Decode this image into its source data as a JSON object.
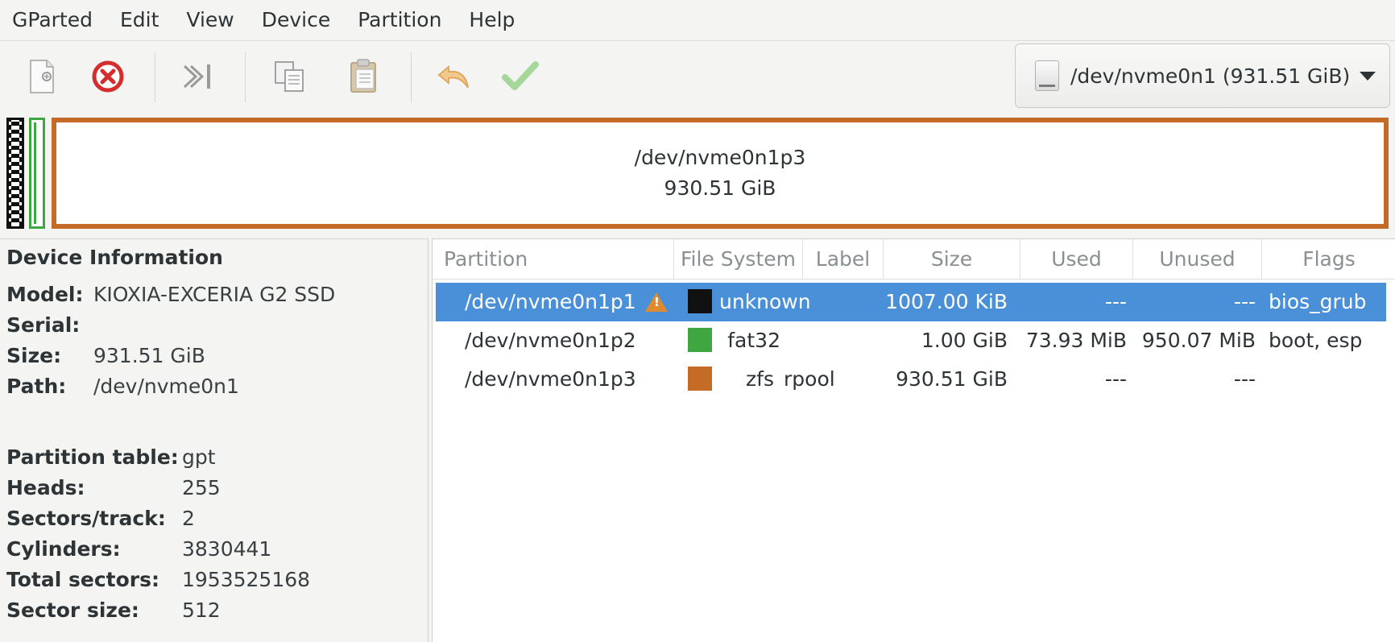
{
  "menubar": [
    "GParted",
    "Edit",
    "View",
    "Device",
    "Partition",
    "Help"
  ],
  "toolbar": {
    "icons": [
      "new-partition-icon",
      "delete-partition-icon",
      "resize-move-icon",
      "copy-icon",
      "paste-icon",
      "undo-icon",
      "apply-icon"
    ],
    "device_selector": "/dev/nvme0n1 (931.51 GiB)"
  },
  "diskmap": {
    "large_segment_name": "/dev/nvme0n1p3",
    "large_segment_size": "930.51 GiB",
    "colors": {
      "p1": "#111111",
      "p2": "#3fa742",
      "p3": "#c46b27"
    }
  },
  "device_info": {
    "title": "Device Information",
    "rows": [
      {
        "key": "Model:",
        "value": "KIOXIA-EXCERIA G2 SSD"
      },
      {
        "key": "Serial:",
        "value": ""
      },
      {
        "key": "Size:",
        "value": "931.51 GiB"
      },
      {
        "key": "Path:",
        "value": "/dev/nvme0n1"
      }
    ],
    "rows2": [
      {
        "key": "Partition table:",
        "value": "gpt"
      },
      {
        "key": "Heads:",
        "value": "255"
      },
      {
        "key": "Sectors/track:",
        "value": "2"
      },
      {
        "key": "Cylinders:",
        "value": "3830441"
      },
      {
        "key": "Total sectors:",
        "value": "1953525168"
      },
      {
        "key": "Sector size:",
        "value": "512"
      }
    ]
  },
  "table": {
    "headers": [
      "Partition",
      "File System",
      "Label",
      "Size",
      "Used",
      "Unused",
      "Flags"
    ],
    "rows": [
      {
        "partition": "/dev/nvme0n1p1",
        "fs": "unknown",
        "label": "",
        "size": "1007.00 KiB",
        "used": "---",
        "unused": "---",
        "flags": "bios_grub",
        "color": "#111111",
        "warning": true,
        "selected": true
      },
      {
        "partition": "/dev/nvme0n1p2",
        "fs": "fat32",
        "label": "",
        "size": "1.00 GiB",
        "used": "73.93 MiB",
        "unused": "950.07 MiB",
        "flags": "boot, esp",
        "color": "#3fa742",
        "warning": false,
        "selected": false
      },
      {
        "partition": "/dev/nvme0n1p3",
        "fs": "zfs",
        "label": "rpool",
        "size": "930.51 GiB",
        "used": "---",
        "unused": "---",
        "flags": "",
        "color": "#c46b27",
        "warning": false,
        "selected": false
      }
    ]
  }
}
